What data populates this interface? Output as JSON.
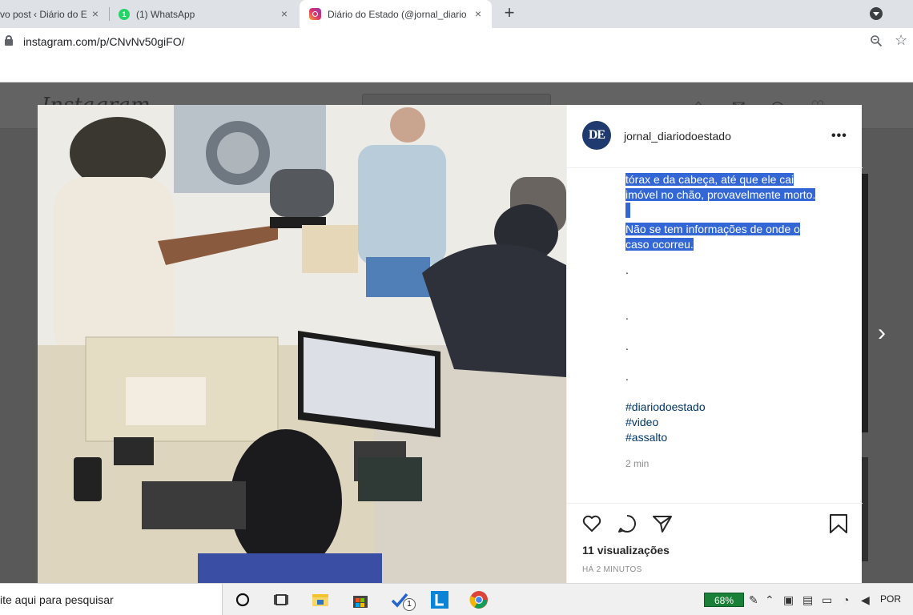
{
  "browser": {
    "tabs": [
      {
        "title": "vo post ‹ Diário do E",
        "close": "×"
      },
      {
        "title": "(1) WhatsApp",
        "badge": "1",
        "close": "×"
      },
      {
        "title": "Diário do Estado (@jornal_diario",
        "close": "×"
      }
    ],
    "new_tab": "+",
    "url": "instagram.com/p/CNvNv50giFO/"
  },
  "instagram": {
    "logo": "Instagram"
  },
  "post": {
    "avatar_text": "DE",
    "username": "jornal_diariodoestado",
    "more": "•••",
    "caption_lines": [
      "tórax e da cabeça, até que ele cai",
      "imóvel no chão, provavelmente morto.",
      "",
      "Não se tem informações de onde o",
      "caso ocorreu."
    ],
    "dots": [
      ".",
      ".",
      ".",
      "."
    ],
    "hashtags": [
      "#diariodoestado",
      "#video",
      "#assalto"
    ],
    "comment_time": "2 min",
    "views": "11 visualizações",
    "time_ago": "HÁ 2 MINUTOS",
    "next_arrow": "›"
  },
  "taskbar": {
    "search_text": "ite aqui para pesquisar",
    "battery": "68%",
    "language": "POR",
    "badge": "1"
  },
  "colors": {
    "selection": "#3367d6",
    "hashtag": "#00376b",
    "battery": "#1a7f37"
  }
}
